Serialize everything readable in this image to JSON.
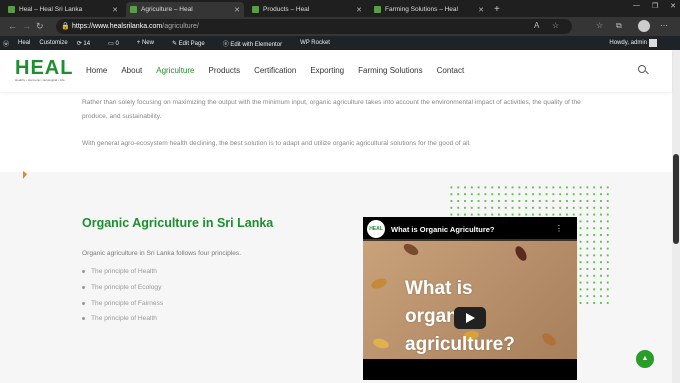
{
  "browser": {
    "tabs": [
      {
        "label": "Heal – Heal Sri Lanka",
        "active": false
      },
      {
        "label": "Agriculture – Heal",
        "active": true
      },
      {
        "label": "Products – Heal",
        "active": false
      },
      {
        "label": "Farming Solutions – Heal",
        "active": false
      }
    ],
    "url_host": "https://www.healsrilanka.com",
    "url_path": "/agriculture/"
  },
  "wp_admin": {
    "site": "Heal",
    "customize": "Customize",
    "updates": "14",
    "comments": "0",
    "new": "New",
    "edit_page": "Edit Page",
    "elementor": "Edit with Elementor",
    "rocket": "WP Rocket",
    "howdy": "Howdy, admin"
  },
  "header": {
    "logo_text": "HEAL",
    "logo_tagline": "Healthy • Harmonic • Ecological • Life",
    "menu": [
      "Home",
      "About",
      "Agriculture",
      "Products",
      "Certification",
      "Exporting",
      "Farming Solutions",
      "Contact"
    ],
    "active_menu": "Agriculture"
  },
  "intro": {
    "para1": "Rather than solely focusing on maximizing the output with the minimum input, organic agriculture takes into account the environmental impact of activities, the quality of the produce, and sustainability.",
    "para2": "With general agro-ecosystem health declining, the best solution is to adapt and utilize organic agricultural solutions for the good of all."
  },
  "section": {
    "heading": "Organic Agriculture in Sri Lanka",
    "lead": "Organic agriculture in Sri Lanka follows four principles.",
    "principles": [
      "The principle of Health",
      "The principle of Ecology",
      "The principle of Fairness",
      "The principle of Health"
    ]
  },
  "video": {
    "channel": "HEAL",
    "title": "What is Organic Agriculture?",
    "overlay_line1": "What is",
    "overlay_line2": "organic",
    "overlay_line3": "agriculture?"
  },
  "colors": {
    "brand_green": "#1e8f2e",
    "dot_green": "#5fc14b"
  }
}
